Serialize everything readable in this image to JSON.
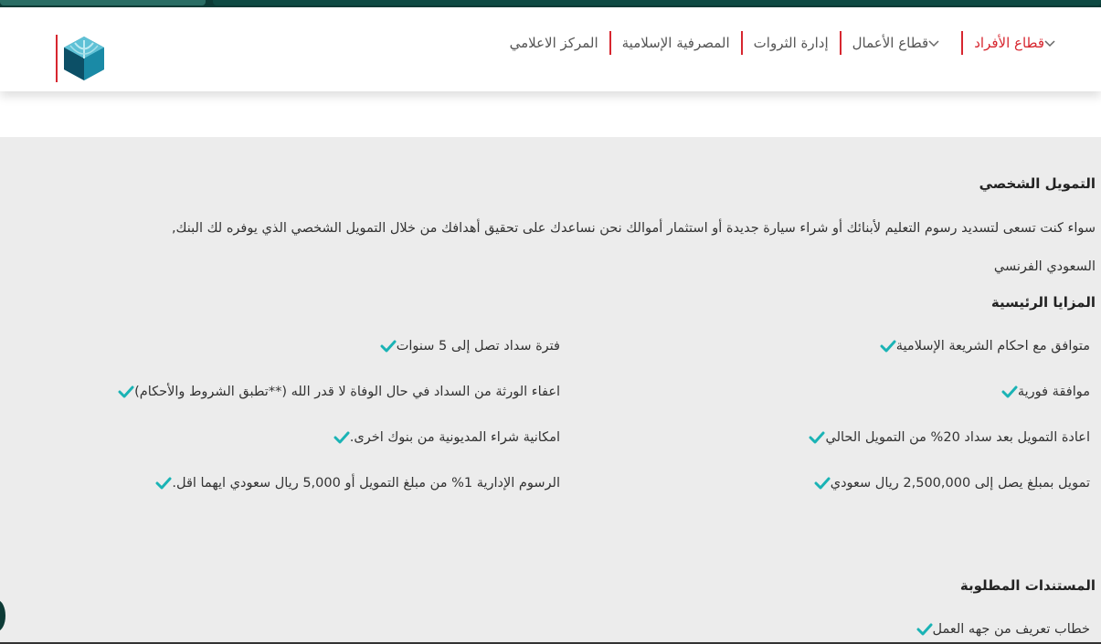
{
  "nav": {
    "items": [
      {
        "label": "قطاع الأفراد",
        "has_dropdown": true
      },
      {
        "label": "قطاع الأعمال",
        "has_dropdown": true
      },
      {
        "label": "إدارة الثروات",
        "has_dropdown": false
      },
      {
        "label": "المصرفية الإسلامية",
        "has_dropdown": false
      },
      {
        "label": "المركز الاعلامي",
        "has_dropdown": false
      }
    ]
  },
  "logo": {
    "icon": "bank-logo-icon"
  },
  "main": {
    "title": "التمويل الشخصي",
    "intro_line1": "سواء كنت تسعى لتسديد رسوم التعليم لأبنائك أو شراء سيارة جديدة أو استثمار أموالك نحن نساعدك على تحقيق أهدافك من خلال التمويل الشخصي الذي يوفره لك البنك,",
    "intro_line2": "السعودي الفرنسي",
    "features_title": "المزايا الرئيسية",
    "features_right": [
      "متوافق مع احكام الشريعة الإسلامية",
      "موافقة فورية",
      "اعادة التمويل بعد سداد 20% من التمويل الحالي",
      "تمويل بمبلغ يصل إلى 2,500,000 ريال سعودي"
    ],
    "features_left": [
      "فترة سداد تصل إلى 5 سنوات",
      "اعفاء الورثة من السداد في حال الوفاة لا قدر الله (**تطبق الشروط والأحكام)",
      "امكانية شراء المديونية من بنوك اخرى.",
      "الرسوم الإدارية 1% من مبلغ التمويل أو 5,000 ريال سعودي ايهما اقل."
    ],
    "documents_title": "المستندات المطلوبة",
    "documents": [
      "خطاب تعريف من جهه العمل"
    ]
  },
  "colors": {
    "accent_red": "#d7262f",
    "check_teal": "#1ab3b5",
    "content_bg": "#ececec",
    "logo_teal": "#0f6f86"
  }
}
